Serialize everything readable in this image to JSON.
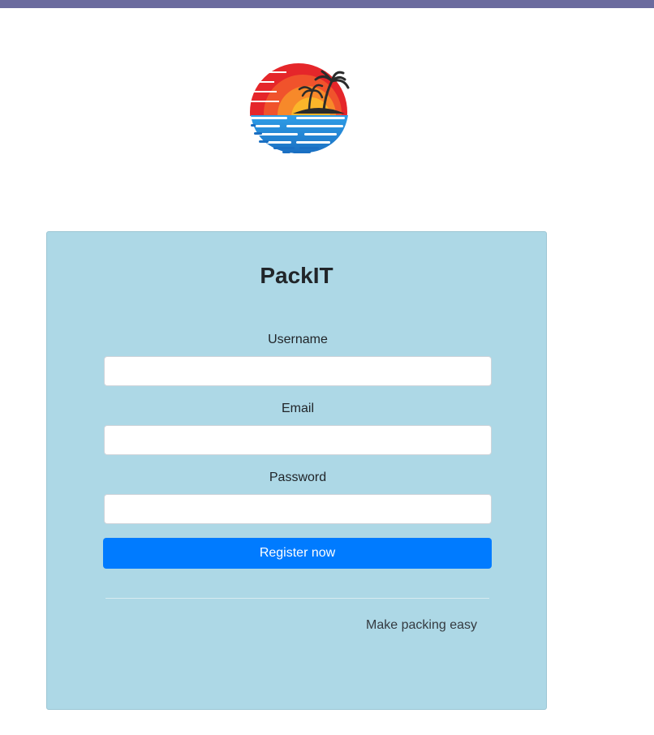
{
  "header": {
    "bar_color": "#6b6b9e"
  },
  "logo": {
    "icon": "tropical-sunset-icon"
  },
  "form": {
    "title": "PackIT",
    "username": {
      "label": "Username",
      "value": "",
      "placeholder": ""
    },
    "email": {
      "label": "Email",
      "value": "",
      "placeholder": ""
    },
    "password": {
      "label": "Password",
      "value": "",
      "placeholder": ""
    },
    "submit_label": "Register now",
    "tagline": "Make packing easy"
  },
  "colors": {
    "card_background": "#add8e6",
    "button": "#007bff",
    "button_text": "#ffffff"
  }
}
